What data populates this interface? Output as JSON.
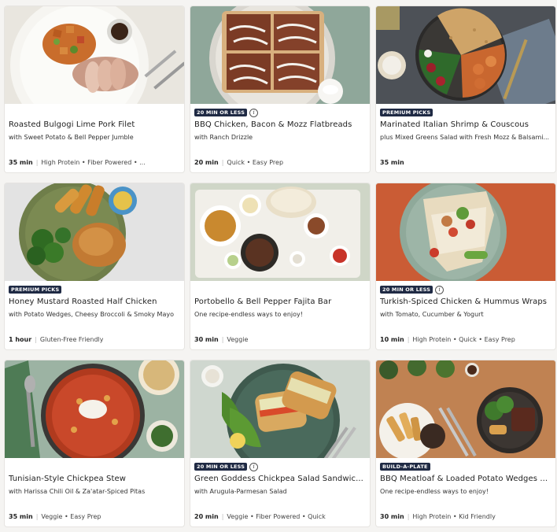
{
  "cards": [
    {
      "badge": "",
      "title": "Roasted Bulgogi Lime Pork Filet",
      "subtitle": "with Sweet Potato & Bell Pepper Jumble",
      "time": "35 min",
      "tags": "High Protein • Fiber Powered • ..."
    },
    {
      "badge": "20 MIN OR LESS",
      "title": "BBQ Chicken, Bacon & Mozz Flatbreads",
      "subtitle": "with Ranch Drizzle",
      "time": "20 min",
      "tags": "Quick • Easy Prep"
    },
    {
      "badge": "PREMIUM PICKS",
      "title": "Marinated Italian Shrimp & Couscous",
      "subtitle": "plus Mixed Greens Salad with Fresh Mozz & Balsami...",
      "time": "35 min",
      "tags": ""
    },
    {
      "badge": "PREMIUM PICKS",
      "title": "Honey Mustard Roasted Half Chicken",
      "subtitle": "with Potato Wedges, Cheesy Broccoli & Smoky Mayo",
      "time": "1 hour",
      "tags": "Gluten-Free Friendly"
    },
    {
      "badge": "",
      "title": "Portobello & Bell Pepper Fajita Bar",
      "subtitle": "One recipe-endless ways to enjoy!",
      "time": "30 min",
      "tags": "Veggie"
    },
    {
      "badge": "20 MIN OR LESS",
      "title": "Turkish-Spiced Chicken & Hummus Wraps",
      "subtitle": "with Tomato, Cucumber & Yogurt",
      "time": "10 min",
      "tags": "High Protein • Quick • Easy Prep"
    },
    {
      "badge": "",
      "title": "Tunisian-Style Chickpea Stew",
      "subtitle": "with Harissa Chili Oil & Za'atar-Spiced Pitas",
      "time": "35 min",
      "tags": "Veggie • Easy Prep"
    },
    {
      "badge": "20 MIN OR LESS",
      "title": "Green Goddess Chickpea Salad Sandwic...",
      "subtitle": "with Arugula-Parmesan Salad",
      "time": "20 min",
      "tags": "Veggie • Fiber Powered • Quick"
    },
    {
      "badge": "BUILD-A-PLATE",
      "title": "BBQ Meatloaf & Loaded Potato Wedges ...",
      "subtitle": "One recipe-endless ways to enjoy!",
      "time": "30 min",
      "tags": "High Protein • Kid Friendly"
    }
  ]
}
